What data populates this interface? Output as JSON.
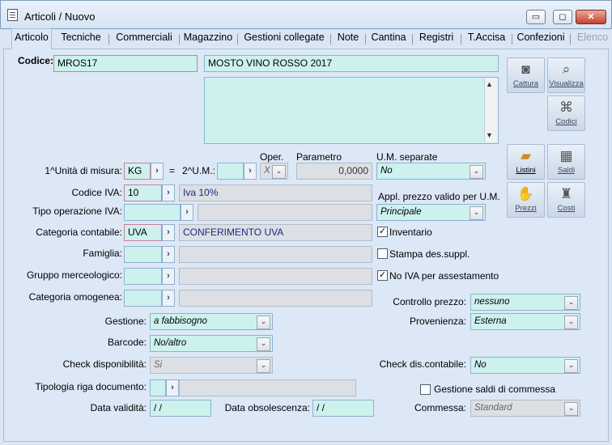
{
  "window": {
    "title": "Articoli / Nuovo",
    "minimize": "▭",
    "maximize": "◻",
    "close": "✕"
  },
  "tabs": [
    "Articolo",
    "Tecniche",
    "Commerciali",
    "Magazzino",
    "Gestioni collegate",
    "Note",
    "Cantina",
    "Registri",
    "T.Accisa",
    "Confezioni",
    "Elenco"
  ],
  "codice": {
    "label": "Codice:",
    "value": "MROS17",
    "description": "MOSTO VINO ROSSO 2017"
  },
  "side_buttons": {
    "cattura": "Cattura",
    "visualizza": "Visualizza",
    "codici": "Codici",
    "listini": "Listini",
    "saldi": "Saldi",
    "prezzi": "Prezzi",
    "costi": "Costi"
  },
  "unita": {
    "label": "1^Unità di misura:",
    "value": "KG",
    "equals": "=",
    "um2_label": "2^U.M.:",
    "oper_label": "Oper.",
    "oper_value": "X",
    "parametro_label": "Parametro",
    "parametro_value": "0,0000",
    "um_separate_label": "U.M. separate",
    "um_separate_value": "No"
  },
  "iva": {
    "label": "Codice IVA:",
    "value": "10",
    "description": "Iva 10%"
  },
  "appl_prezzo": {
    "label": "Appl. prezzo valido per U.M.",
    "value": "Principale"
  },
  "tipo_op_iva": {
    "label": "Tipo operazione IVA:"
  },
  "categoria_contabile": {
    "label": "Categoria contabile:",
    "value": "UVA",
    "description": "CONFERIMENTO UVA"
  },
  "famiglia": {
    "label": "Famiglia:"
  },
  "gruppo": {
    "label": "Gruppo merceologico:"
  },
  "categoria_omogenea": {
    "label": "Categoria omogenea:"
  },
  "checks": {
    "inventario": "Inventario",
    "inventario_checked": "✓",
    "stampa": "Stampa des.suppl.",
    "no_iva": "No IVA per assestamento",
    "no_iva_checked": "✓",
    "gestione_saldi": "Gestione saldi di commessa"
  },
  "controllo_prezzo": {
    "label": "Controllo prezzo:",
    "value": "nessuno"
  },
  "gestione": {
    "label": "Gestione:",
    "value": "a fabbisogno"
  },
  "provenienza": {
    "label": "Provenienza:",
    "value": "Esterna"
  },
  "barcode": {
    "label": "Barcode:",
    "value": "No/altro"
  },
  "check_disp": {
    "label": "Check disponibilità:",
    "value": "Si"
  },
  "check_dis_contabile": {
    "label": "Check dis.contabile:",
    "value": "No"
  },
  "tipologia_riga": {
    "label": "Tipologia riga documento:"
  },
  "data_validita": {
    "label": "Data validità:",
    "value": "/ /"
  },
  "data_obsolescenza": {
    "label": "Data obsolescenza:",
    "value": "/ /"
  },
  "commessa": {
    "label": "Commessa:",
    "value": "Standard"
  },
  "lookup_glyph": "›",
  "combo_glyph": "⌄",
  "scroll_up": "▲",
  "scroll_down": "▼"
}
